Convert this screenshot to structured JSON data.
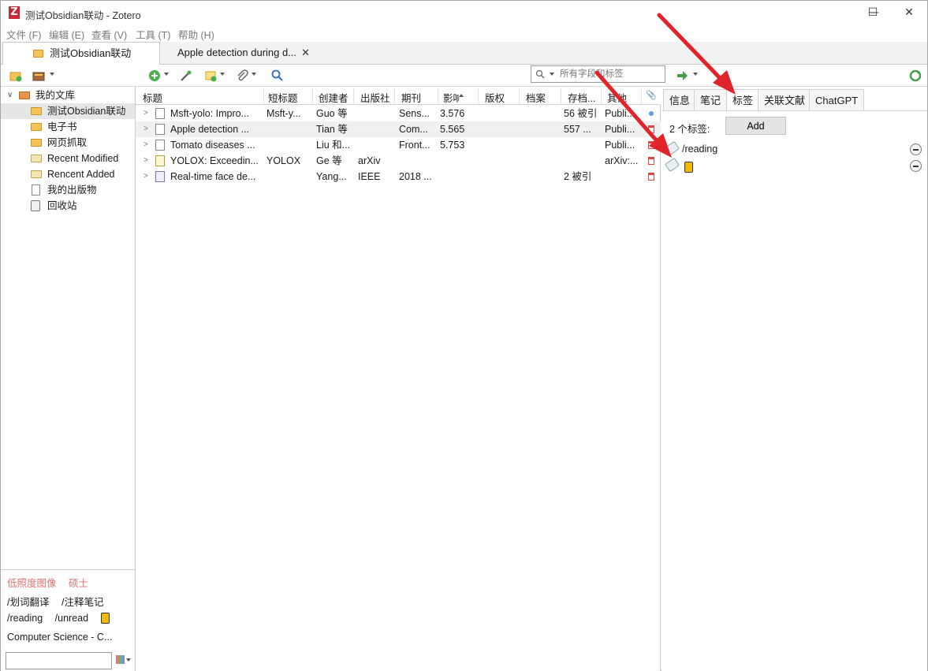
{
  "window": {
    "title": "测试Obsidian联动 - Zotero",
    "logo": "Z",
    "minimize_label": "—",
    "maximize_label": "☐",
    "close_label": "✕"
  },
  "menu": [
    "文件 (F)",
    "编辑 (E)",
    "查看 (V)",
    "工具 (T)",
    "帮助 (H)"
  ],
  "tabs": [
    {
      "label": "测试Obsidian联动",
      "active": true
    },
    {
      "label": "Apple detection during d...",
      "close": "✕"
    }
  ],
  "search": {
    "placeholder": "所有字段和标签"
  },
  "collections": [
    {
      "label": "我的文库",
      "type": "library",
      "twisty": "∨"
    },
    {
      "label": "测试Obsidian联动",
      "type": "folder",
      "selected": true
    },
    {
      "label": "电子书",
      "type": "folder"
    },
    {
      "label": "网页抓取",
      "type": "folder"
    },
    {
      "label": "Recent Modified",
      "type": "smart"
    },
    {
      "label": "Rencent Added",
      "type": "smart"
    },
    {
      "label": "我的出版物",
      "type": "doc"
    },
    {
      "label": "回收站",
      "type": "trash"
    }
  ],
  "tag_selector": {
    "row1": [
      "低照度图像",
      "硕士"
    ],
    "row2": [
      "/划词翻译",
      "/注释笔记"
    ],
    "row3": [
      "/reading",
      "/unread"
    ],
    "row4": "Computer Science - C..."
  },
  "columns": [
    "标题",
    "短标题",
    "创建者",
    "出版社",
    "期刊",
    "影响因子",
    "版权",
    "档案",
    "存档...",
    "其他",
    "📎"
  ],
  "items": [
    {
      "title": "Msft-yolo: Impro...",
      "short": "Msft-y...",
      "creator": "Guo 等",
      "publisher": "",
      "journal": "Sens...",
      "if": "3.576",
      "cite": "56 被引",
      "extra": "Publi...",
      "att": "blue",
      "icon": "journal"
    },
    {
      "title": "Apple detection ...",
      "short": "",
      "creator": "Tian 等",
      "publisher": "",
      "journal": "Com...",
      "if": "5.565",
      "cite": "557 ...",
      "extra": "Publi...",
      "att": "pdf",
      "icon": "journal",
      "selected": true
    },
    {
      "title": "Tomato diseases ...",
      "short": "",
      "creator": "Liu 和...",
      "publisher": "",
      "journal": "Front...",
      "if": "5.753",
      "cite": "",
      "extra": "Publi...",
      "att": "pdf",
      "icon": "journal"
    },
    {
      "title": "YOLOX: Exceedin...",
      "short": "YOLOX",
      "creator": "Ge 等",
      "publisher": "arXiv",
      "journal": "",
      "if": "",
      "cite": "",
      "extra": "arXiv:...",
      "att": "pdf",
      "icon": "preprint"
    },
    {
      "title": "Real-time face de...",
      "short": "",
      "creator": "Yang...",
      "publisher": "IEEE",
      "journal": "2018 ...",
      "if": "",
      "cite": "2 被引",
      "extra": "",
      "att": "pdf",
      "icon": "conf"
    }
  ],
  "right": {
    "tabs": [
      "信息",
      "笔记",
      "标签",
      "关联文献",
      "ChatGPT"
    ],
    "active_tab": "标签",
    "tag_count": "2 个标签:",
    "add_label": "Add",
    "tags": [
      "/reading",
      ""
    ]
  },
  "colors": {
    "accent_red": "#e0242a",
    "tag_yellow": "#f5b800",
    "logo_red": "#cc2936"
  }
}
